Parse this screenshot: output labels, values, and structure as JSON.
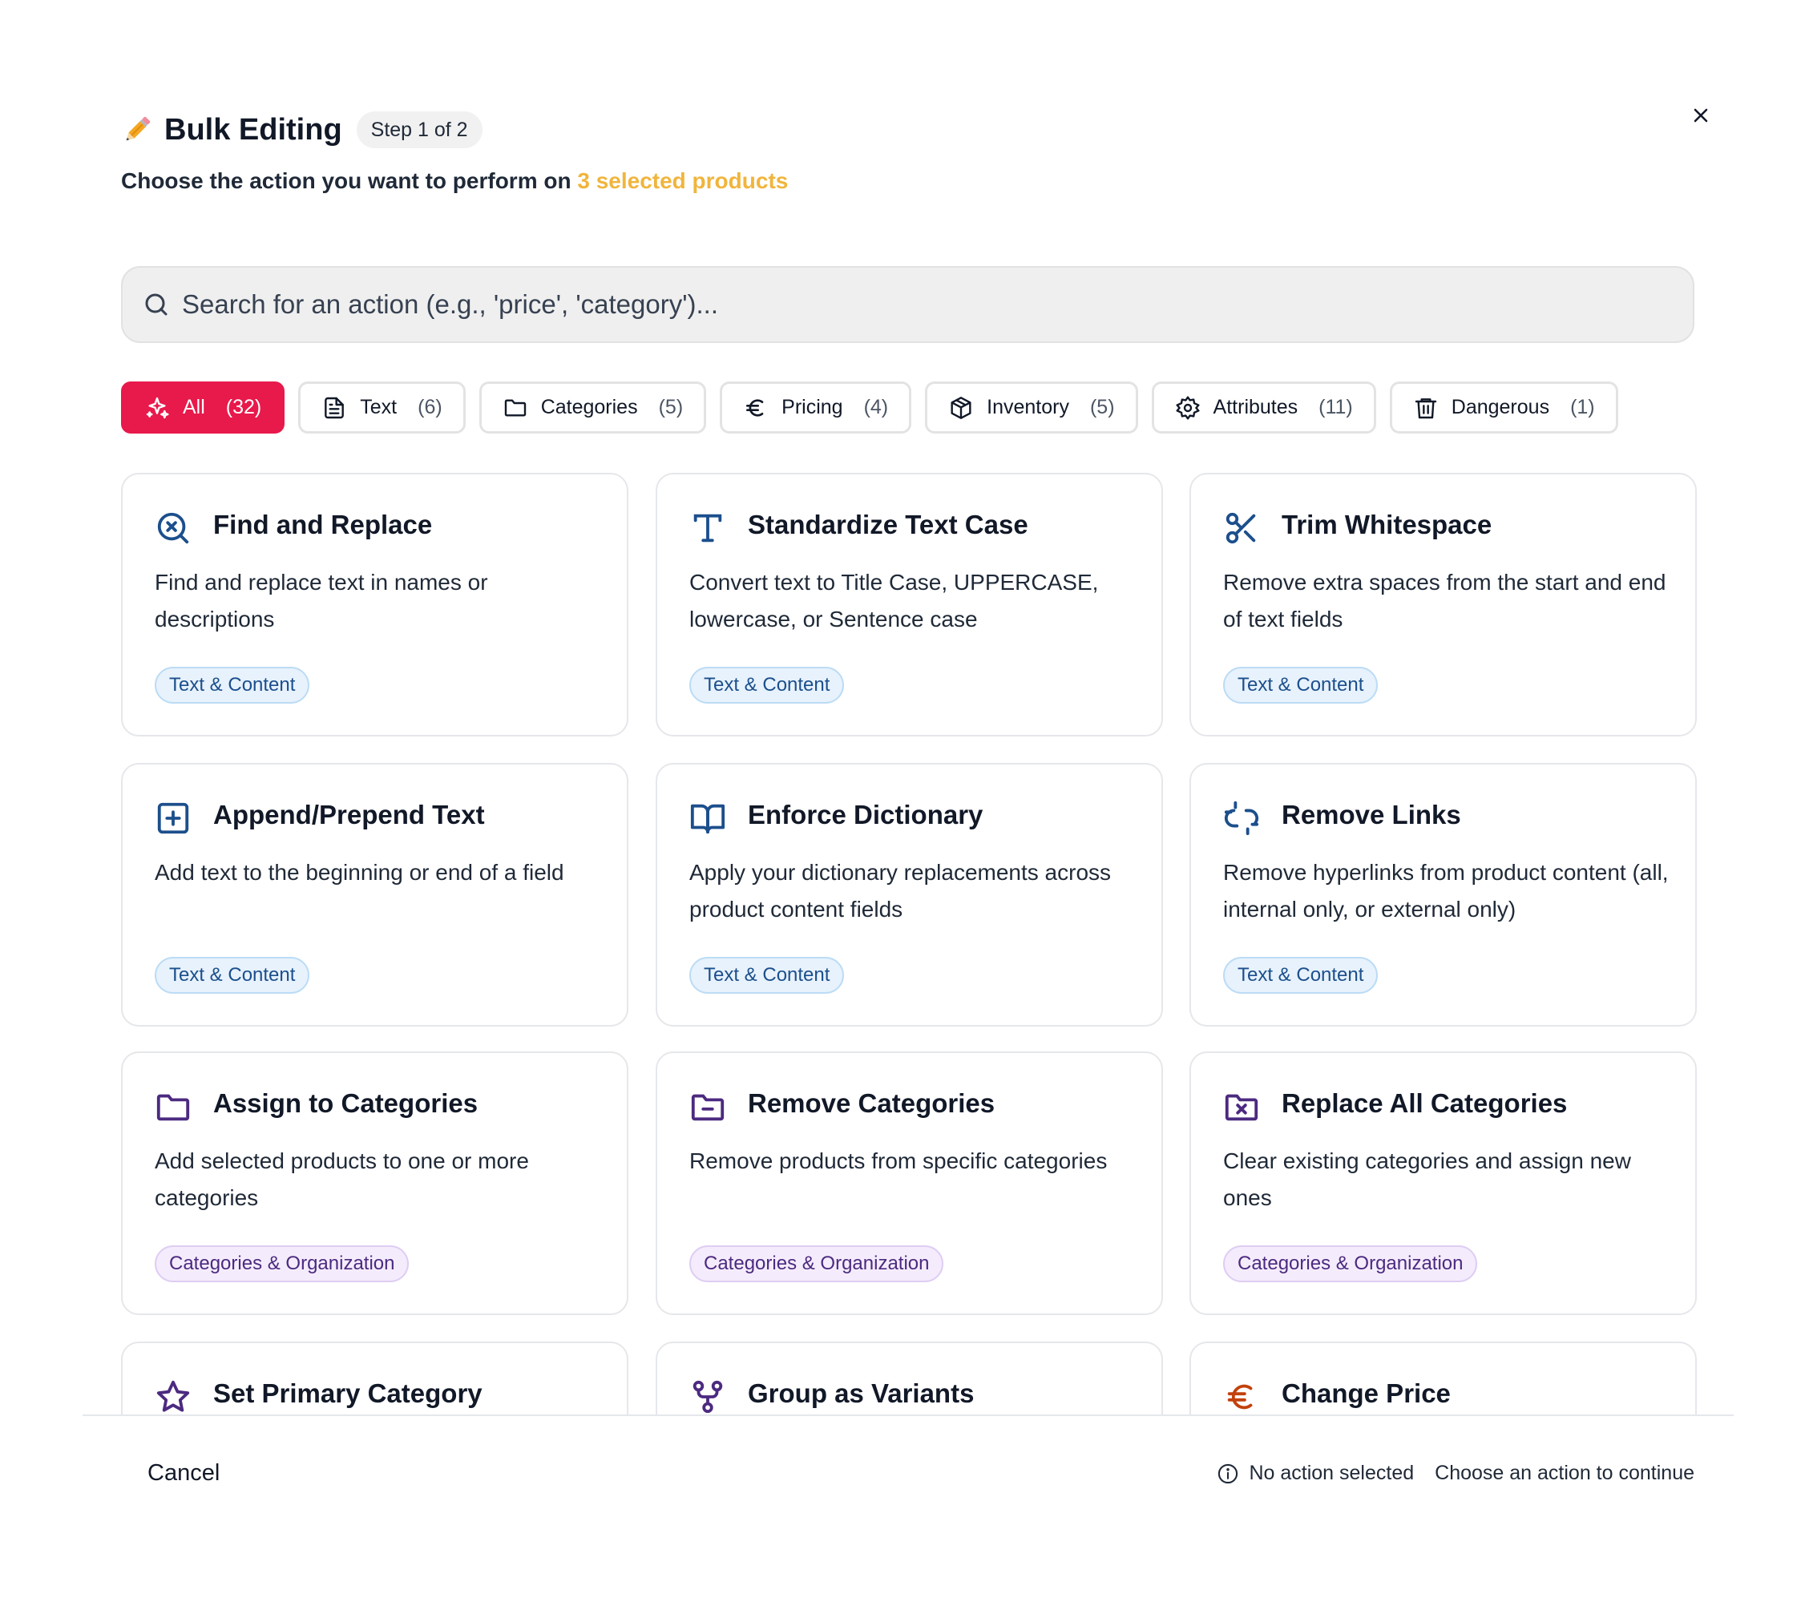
{
  "header": {
    "title": "Bulk Editing",
    "step": "Step 1 of 2",
    "subtitle_prefix": "Choose the action you want to perform on",
    "subtitle_highlight": "3 selected products"
  },
  "search": {
    "placeholder": "Search for an action (e.g., 'price', 'category')..."
  },
  "filters": [
    {
      "label": "All",
      "count": "(32)",
      "icon": "sparkles-icon",
      "active": true
    },
    {
      "label": "Text",
      "count": "(6)",
      "icon": "document-icon"
    },
    {
      "label": "Categories",
      "count": "(5)",
      "icon": "folder-icon"
    },
    {
      "label": "Pricing",
      "count": "(4)",
      "icon": "euro-icon"
    },
    {
      "label": "Inventory",
      "count": "(5)",
      "icon": "box-icon"
    },
    {
      "label": "Attributes",
      "count": "(11)",
      "icon": "gear-icon"
    },
    {
      "label": "Dangerous",
      "count": "(1)",
      "icon": "trash-icon"
    }
  ],
  "actions": [
    {
      "title": "Find and Replace",
      "desc": "Find and replace text in names or descriptions",
      "tag": "Text & Content",
      "icon": "search-x-icon"
    },
    {
      "title": "Standardize Text Case",
      "desc": "Convert text to Title Case, UPPERCASE, lowercase, or Sentence case",
      "tag": "Text & Content",
      "icon": "type-icon"
    },
    {
      "title": "Trim Whitespace",
      "desc": "Remove extra spaces from the start and end of text fields",
      "tag": "Text & Content",
      "icon": "scissors-icon"
    },
    {
      "title": "Append/Prepend Text",
      "desc": "Add text to the beginning or end of a field",
      "tag": "Text & Content",
      "icon": "plus-square-icon"
    },
    {
      "title": "Enforce Dictionary",
      "desc": "Apply your dictionary replacements across product content fields",
      "tag": "Text & Content",
      "icon": "book-icon"
    },
    {
      "title": "Remove Links",
      "desc": "Remove hyperlinks from product content (all, internal only, or external only)",
      "tag": "Text & Content",
      "icon": "unlink-icon"
    },
    {
      "title": "Assign to Categories",
      "desc": "Add selected products to one or more categories",
      "tag": "Categories & Organization",
      "icon": "folder-icon"
    },
    {
      "title": "Remove Categories",
      "desc": "Remove products from specific categories",
      "tag": "Categories & Organization",
      "icon": "folder-minus-icon"
    },
    {
      "title": "Replace All Categories",
      "desc": "Clear existing categories and assign new ones",
      "tag": "Categories & Organization",
      "icon": "folder-x-icon"
    },
    {
      "title": "Set Primary Category",
      "desc": "",
      "tag": "",
      "icon": "star-icon"
    },
    {
      "title": "Group as Variants",
      "desc": "",
      "tag": "",
      "icon": "git-fork-icon"
    },
    {
      "title": "Change Price",
      "desc": "",
      "tag": "",
      "icon": "euro-icon"
    }
  ],
  "footer": {
    "cancel": "Cancel",
    "status": "No action selected",
    "hint": "Choose an action to continue"
  },
  "colors": {
    "accent": "#e8194b",
    "highlight": "#f0b53c",
    "text_icon": "#1c4f8c",
    "category_icon": "#4c2a80",
    "pricing_icon": "#c2410c"
  }
}
